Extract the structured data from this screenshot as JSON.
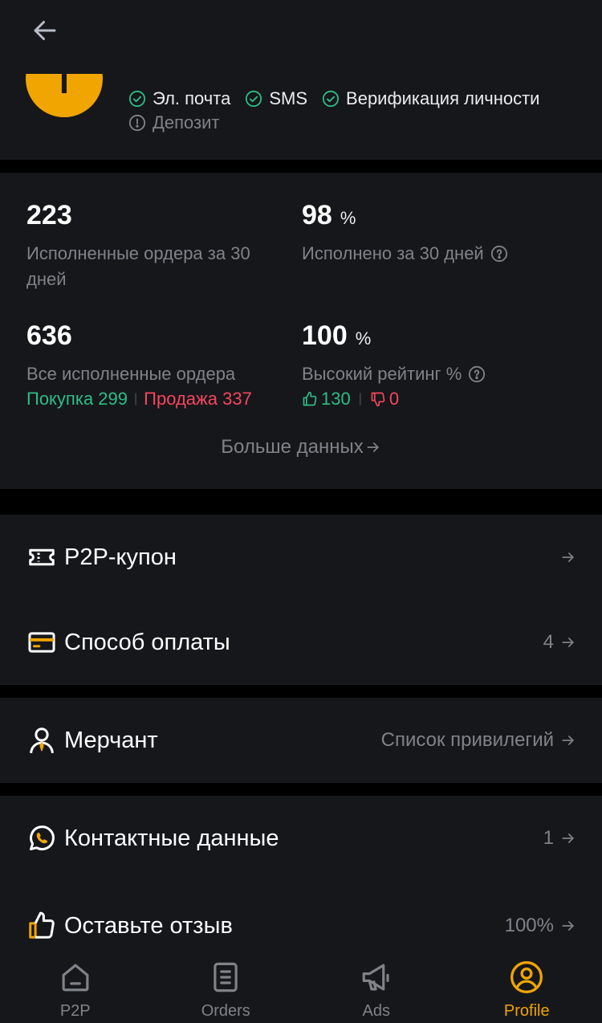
{
  "avatar": {
    "letter": "T"
  },
  "verification": [
    {
      "label": "Эл. почта",
      "status": "verified"
    },
    {
      "label": "SMS",
      "status": "verified"
    },
    {
      "label": "Верификация личности",
      "status": "verified"
    },
    {
      "label": "Депозит",
      "status": "pending"
    }
  ],
  "stats": {
    "orders_30d": {
      "value": "223",
      "label": "Исполненные ордера за 30 дней"
    },
    "completion_30d": {
      "value": "98",
      "unit": "%",
      "label": "Исполнено за 30 дней"
    },
    "total_orders": {
      "value": "636",
      "label": "Все исполненные ордера",
      "buy_label": "Покупка 299",
      "sell_label": "Продажа 337"
    },
    "positive_rating": {
      "value": "100",
      "unit": "%",
      "label": "Высокий рейтинг %",
      "likes": "130",
      "dislikes": "0"
    },
    "more_label": "Больше данных"
  },
  "menu": {
    "coupon": {
      "label": "P2P-купон"
    },
    "payment": {
      "label": "Способ оплаты",
      "count": "4"
    },
    "merchant": {
      "label": "Мерчант",
      "right": "Список привилегий"
    },
    "contacts": {
      "label": "Контактные данные",
      "count": "1"
    },
    "feedback": {
      "label": "Оставьте отзыв",
      "right": "100%"
    }
  },
  "nav": [
    {
      "label": "P2P",
      "icon": "home-icon"
    },
    {
      "label": "Orders",
      "icon": "orders-icon"
    },
    {
      "label": "Ads",
      "icon": "megaphone-icon"
    },
    {
      "label": "Profile",
      "icon": "profile-icon",
      "active": true
    }
  ],
  "colors": {
    "accent": "#f0a500",
    "green": "#2ebd85",
    "red": "#f6465d",
    "card": "#16171b"
  }
}
